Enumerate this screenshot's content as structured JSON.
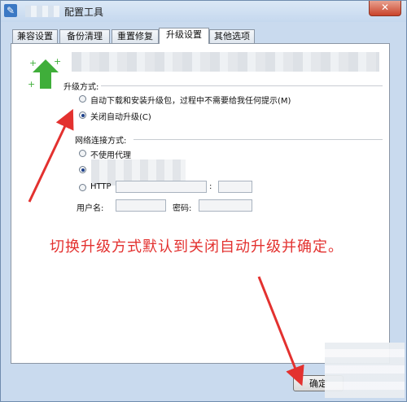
{
  "window": {
    "title": "配置工具",
    "close_label": "✕"
  },
  "tabs": [
    {
      "label": "兼容设置",
      "active": false
    },
    {
      "label": "备份清理",
      "active": false
    },
    {
      "label": "重置修复",
      "active": false
    },
    {
      "label": "升级设置",
      "active": true
    },
    {
      "label": "其他选项",
      "active": false
    }
  ],
  "upgrade": {
    "section_label": "升级方式:",
    "option_auto": "自动下载和安装升级包，过程中不需要给我任何提示(M)",
    "option_off": "关闭自动升级(C)",
    "selected": "off"
  },
  "network": {
    "section_label": "网络连接方式:",
    "option_no_proxy": "不使用代理",
    "option_http": "HTTP",
    "port_separator": ":",
    "username_label": "用户名:",
    "password_label": "密码:",
    "selected": "second"
  },
  "annotation": {
    "text": "切换升级方式默认到关闭自动升级并确定。",
    "color": "#e3312f"
  },
  "footer": {
    "ok_label": "确定"
  },
  "colors": {
    "accent_green": "#3fae3a",
    "annotation_red": "#e3312f",
    "titlebar": "#c9daee"
  }
}
